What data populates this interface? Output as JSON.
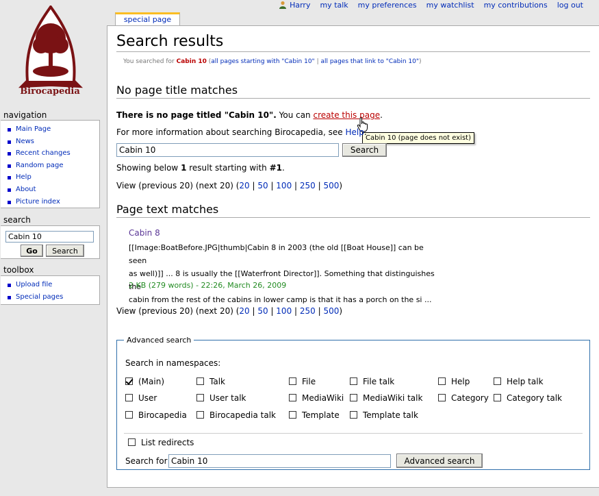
{
  "personal": {
    "items": [
      "Harry",
      "my talk",
      "my preferences",
      "my watchlist",
      "my contributions",
      "log out"
    ]
  },
  "tab": {
    "label": "special page"
  },
  "logo": {
    "text": "Birocapedia"
  },
  "heading": "Search results",
  "subtitle": {
    "prefix": "You searched for ",
    "query": "Cabin 10",
    "open": " (",
    "link1": "all pages starting with \"Cabin 10\"",
    "sep": " | ",
    "link2": "all pages that link to \"Cabin 10\"",
    "close": ")"
  },
  "no_title": {
    "heading": "No page title matches",
    "bold": "There is no page titled \"Cabin 10\".",
    "text": " You can ",
    "link": "create this page",
    "end": "."
  },
  "tooltip": "Cabin 10 (page does not exist)",
  "info": {
    "text": "For more information about searching Birocapedia, see ",
    "link": "Help",
    "end": "."
  },
  "search_form": {
    "value": "Cabin 10",
    "button": "Search"
  },
  "showing": {
    "prefix": "Showing below ",
    "count": "1",
    "mid": " result starting with ",
    "start": "#1",
    "end": "."
  },
  "pager": {
    "prefix": "View (previous 20) (next 20) (",
    "links": [
      "20",
      "50",
      "100",
      "250",
      "500"
    ],
    "sep": " | ",
    "end": ")"
  },
  "text_matches": {
    "heading": "Page text matches"
  },
  "result": {
    "title": "Cabin 8",
    "lines": [
      "[[Image:BoatBefore.JPG|thumb|Cabin 8 in 2003 (the old [[Boat House]] can be seen",
      "as well)]] ... 8 is usually the [[Waterfront Director]]. Something that distinguishes the",
      "cabin from the rest of the cabins in lower camp is that it has a porch on the si ..."
    ],
    "meta": "2 KB (279 words) - 22:26, March 26, 2009"
  },
  "advanced": {
    "legend": "Advanced search",
    "ns_label": "Search in namespaces:",
    "namespaces": [
      {
        "label": "(Main)",
        "checked": true
      },
      {
        "label": "Talk",
        "checked": false
      },
      {
        "label": "File",
        "checked": false
      },
      {
        "label": "File talk",
        "checked": false
      },
      {
        "label": "Help",
        "checked": false
      },
      {
        "label": "Help talk",
        "checked": false
      },
      {
        "label": "User",
        "checked": false
      },
      {
        "label": "User talk",
        "checked": false
      },
      {
        "label": "MediaWiki",
        "checked": false
      },
      {
        "label": "MediaWiki talk",
        "checked": false
      },
      {
        "label": "Category",
        "checked": false
      },
      {
        "label": "Category talk",
        "checked": false
      },
      {
        "label": "Birocapedia",
        "checked": false
      },
      {
        "label": "Birocapedia talk",
        "checked": false
      },
      {
        "label": "Template",
        "checked": false
      },
      {
        "label": "Template talk",
        "checked": false
      }
    ],
    "redirects": "List redirects",
    "search_for": "Search for",
    "value": "Cabin 10",
    "button": "Advanced search"
  },
  "sidebar": {
    "navigation": {
      "heading": "navigation",
      "items": [
        "Main Page",
        "News",
        "Recent changes",
        "Random page",
        "Help",
        "About",
        "Picture index"
      ]
    },
    "search": {
      "heading": "search",
      "value": "Cabin 10",
      "go": "Go",
      "button": "Search"
    },
    "toolbox": {
      "heading": "toolbox",
      "items": [
        "Upload file",
        "Special pages"
      ]
    }
  },
  "colors": {
    "link": "#002bb8",
    "redlink": "#ba0000",
    "visited": "#5a3696",
    "meta": "#228b22",
    "tab_accent": "#fabd23",
    "logo": "#7a1214"
  }
}
